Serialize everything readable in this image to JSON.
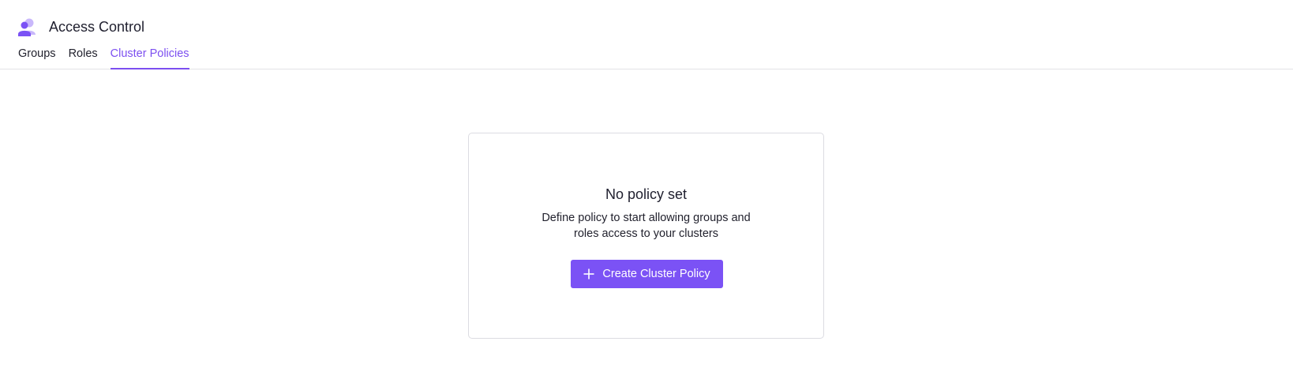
{
  "header": {
    "title": "Access Control",
    "icon": "users-icon"
  },
  "tabs": [
    {
      "label": "Groups",
      "active": false
    },
    {
      "label": "Roles",
      "active": false
    },
    {
      "label": "Cluster Policies",
      "active": true
    }
  ],
  "empty_state": {
    "title": "No policy set",
    "description": "Define policy to start allowing groups and roles access to your clusters",
    "button_label": "Create Cluster Policy",
    "button_icon": "plus-icon"
  },
  "colors": {
    "accent": "#7b52f5",
    "accent_text": "#7c4ff0",
    "border": "#dcdce2"
  }
}
